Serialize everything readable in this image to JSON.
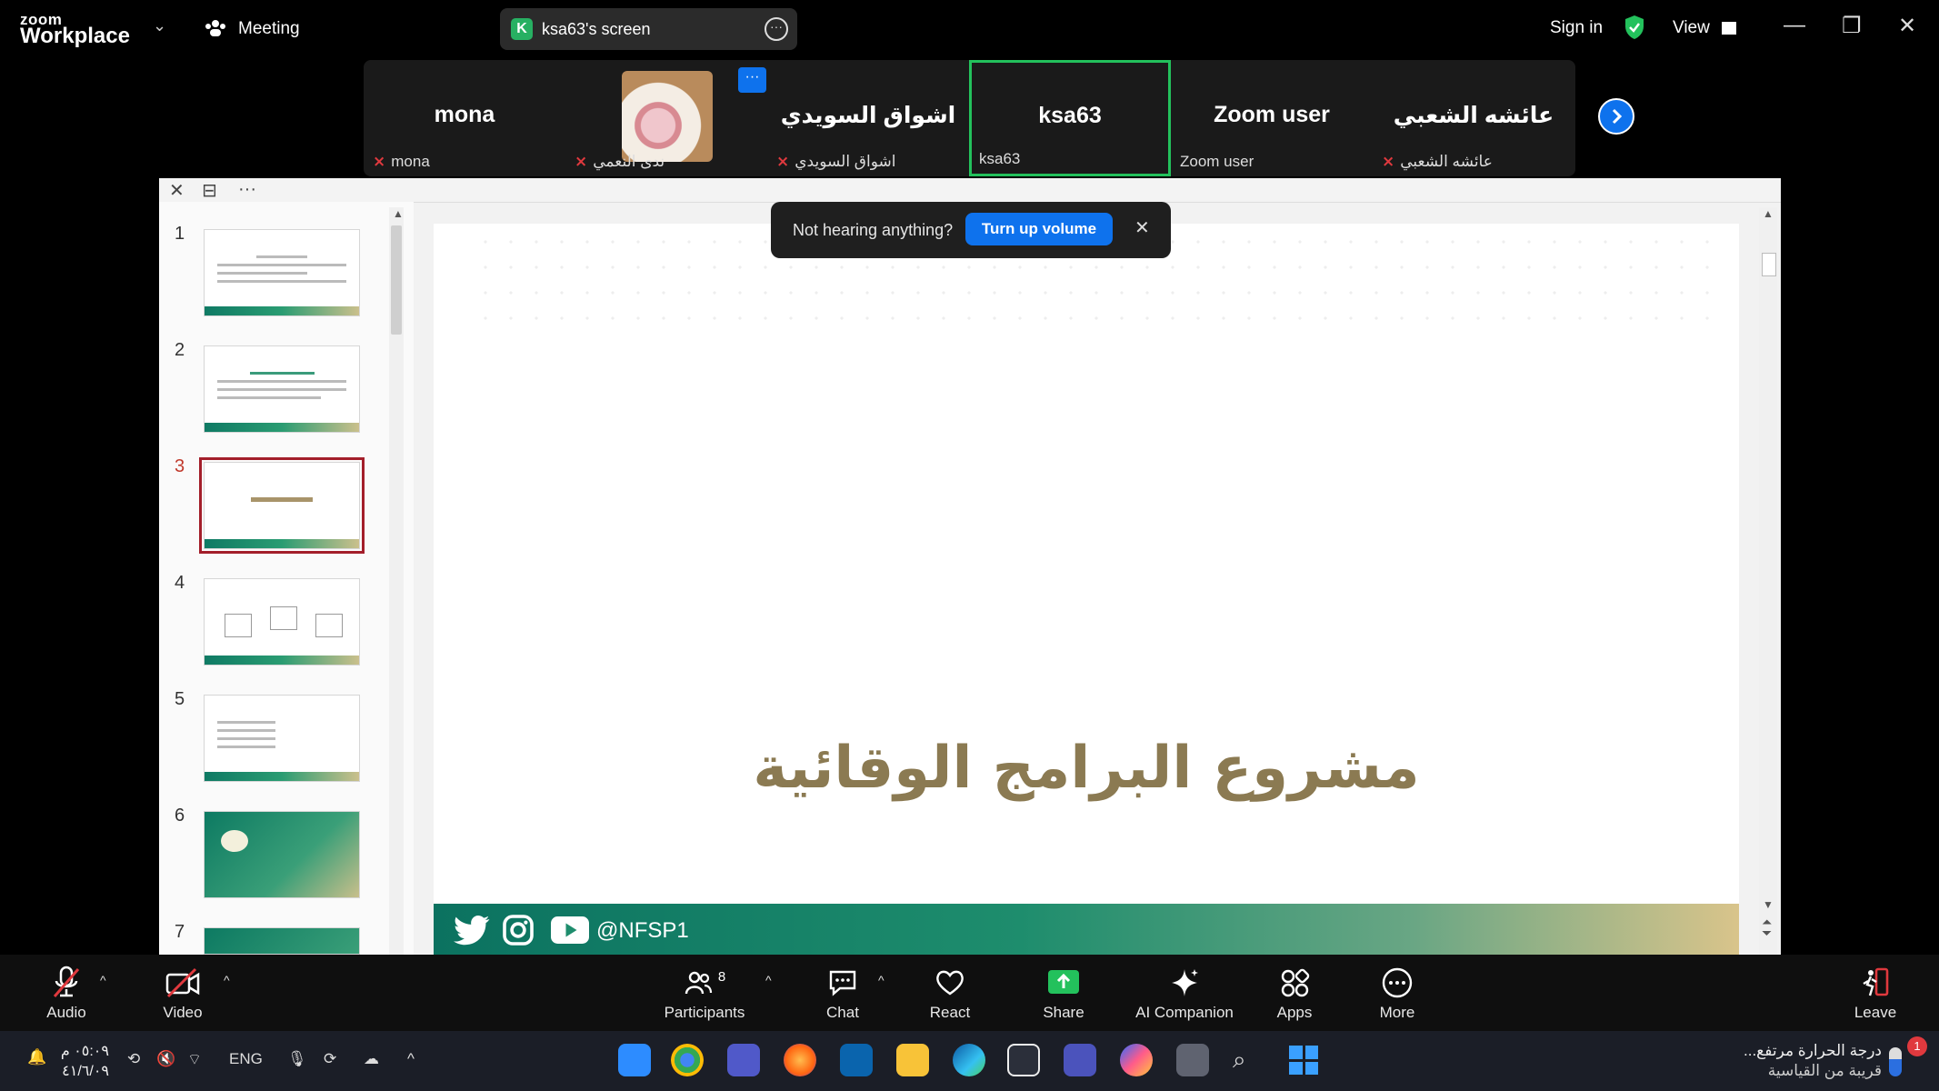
{
  "titlebar": {
    "brand_top": "zoom",
    "brand_bottom": "Workplace",
    "meeting_label": "Meeting",
    "screen_share_initial": "K",
    "screen_share_label": "ksa63's screen",
    "sign_in": "Sign in",
    "view": "View"
  },
  "participants": [
    {
      "display": "mona",
      "label": "mona",
      "muted": true
    },
    {
      "display": "",
      "label": "ندى النعمي",
      "muted": true,
      "has_photo": true
    },
    {
      "display": "اشواق السويدي",
      "label": "اشواق السويدي",
      "muted": true
    },
    {
      "display": "ksa63",
      "label": "ksa63",
      "muted": false,
      "active": true
    },
    {
      "display": "Zoom user",
      "label": "Zoom user",
      "muted": false
    },
    {
      "display": "عائشه الشعبي",
      "label": "عائشه الشعبي",
      "muted": true
    }
  ],
  "notification": {
    "message": "Not hearing anything?",
    "action": "Turn up volume"
  },
  "slides": {
    "numbers": [
      "1",
      "2",
      "3",
      "4",
      "5",
      "6",
      "7"
    ],
    "selected": "3",
    "current_title": "مشروع البرامج الوقائية",
    "footer_handle": "@NFSP1"
  },
  "toolbar": {
    "audio": "Audio",
    "video": "Video",
    "participants": "Participants",
    "participants_count": "8",
    "chat": "Chat",
    "react": "React",
    "share": "Share",
    "ai_companion": "AI Companion",
    "apps": "Apps",
    "more": "More",
    "leave": "Leave"
  },
  "taskbar": {
    "time": "٠٥:٠٩ م",
    "date": "٤١/٦/٠٩",
    "lang": "ENG",
    "weather_title": "درجة الحرارة مرتفع...",
    "weather_sub": "قريبة من القياسية",
    "weather_badge": "1"
  },
  "colors": {
    "zoom_blue": "#0e72ed",
    "active_green": "#23c15c",
    "muted_red": "#e0393e",
    "slide_title": "#8b7a52",
    "selected_thumb": "#a31e2a"
  }
}
